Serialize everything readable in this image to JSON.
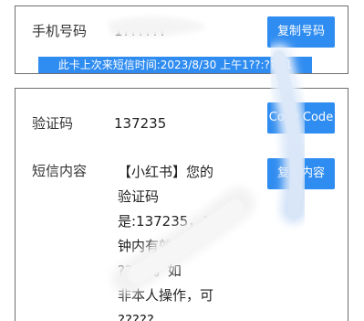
{
  "phone_card": {
    "phone_label": "手机号码",
    "phone_value": "1??????",
    "copy_phone_button": "复制号码",
    "last_sms_banner": "此卡上次来短信时间:2023/8/30 上午1??:??:?1"
  },
  "sms_card": {
    "code_label": "验证码",
    "code_value": "137235",
    "copy_code_button": "Copy Code",
    "content_label": "短信内容",
    "copy_content_button": "复制内容",
    "sms_lines": [
      "【小红书】您的",
      "验证码",
      "是:137235，1分",
      "钟内有效，",
      "?????。如",
      "非本人操作，可",
      "?????"
    ]
  },
  "colors": {
    "accent": "#2f8cf0",
    "border": "#6f6f6f",
    "text": "#333333"
  }
}
